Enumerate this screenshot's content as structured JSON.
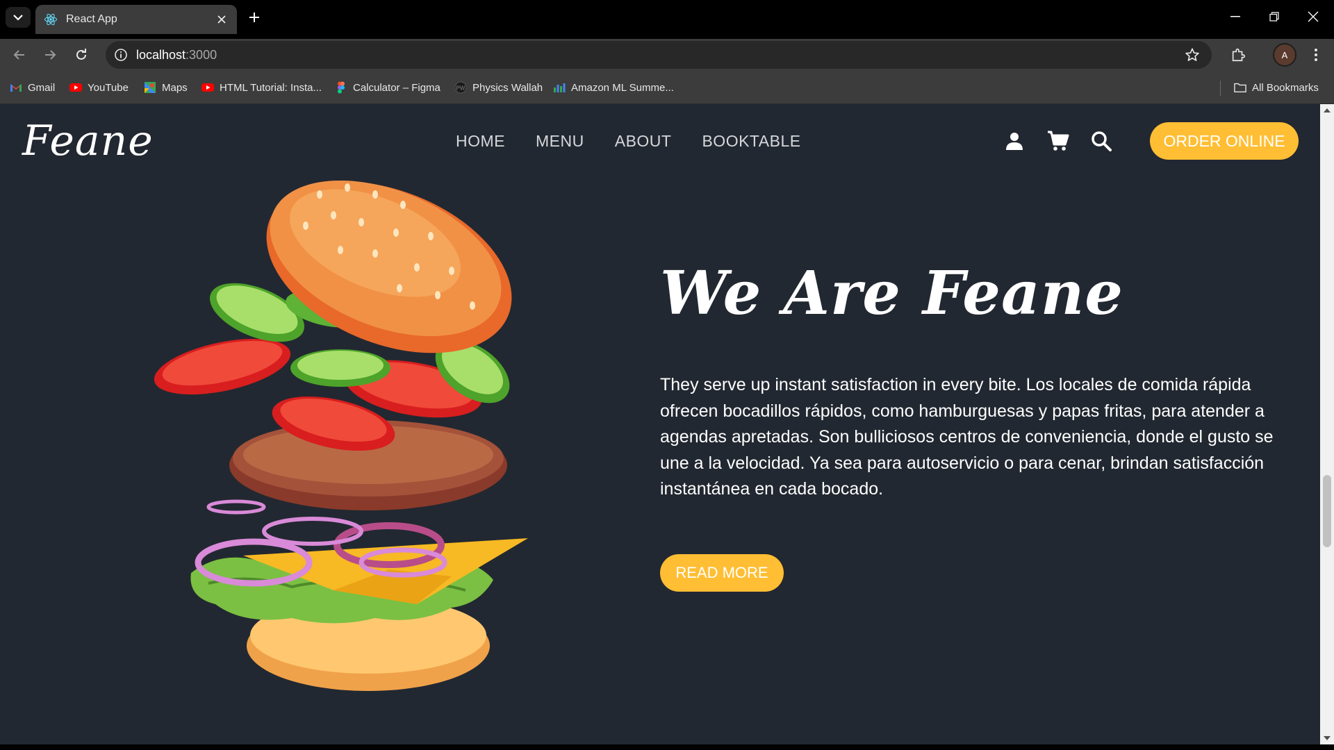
{
  "browser": {
    "tab_title": "React App",
    "url_host": "localhost",
    "url_port": ":3000",
    "avatar_letter": "A",
    "bookmarks": [
      {
        "label": "Gmail",
        "icon": "gmail-icon"
      },
      {
        "label": "YouTube",
        "icon": "youtube-icon"
      },
      {
        "label": "Maps",
        "icon": "maps-icon"
      },
      {
        "label": "HTML Tutorial: Insta...",
        "icon": "youtube-icon"
      },
      {
        "label": "Calculator – Figma",
        "icon": "figma-icon"
      },
      {
        "label": "Physics Wallah",
        "icon": "pw-icon"
      },
      {
        "label": "Amazon ML Summe...",
        "icon": "chart-icon"
      }
    ],
    "all_bookmarks": "All Bookmarks"
  },
  "site": {
    "logo": "Feane",
    "nav": [
      "HOME",
      "MENU",
      "ABOUT",
      "BOOKTABLE"
    ],
    "order_button": "ORDER ONLINE",
    "hero_title": "We Are Feane",
    "hero_text": "They serve up instant satisfaction in every bite. Los locales de comida rápida ofrecen bocadillos rápidos, como hamburguesas y papas fritas, para atender a agendas apretadas. Son bulliciosos centros de conveniencia, donde el gusto se une a la velocidad. Ya sea para autoservicio o para cenar, brindan satisfacción instantánea en cada bocado.",
    "read_more": "READ MORE"
  },
  "colors": {
    "page_bg": "#222831",
    "accent": "#ffbe33",
    "chrome_dark": "#000000",
    "chrome_toolbar": "#3c3c3c"
  }
}
